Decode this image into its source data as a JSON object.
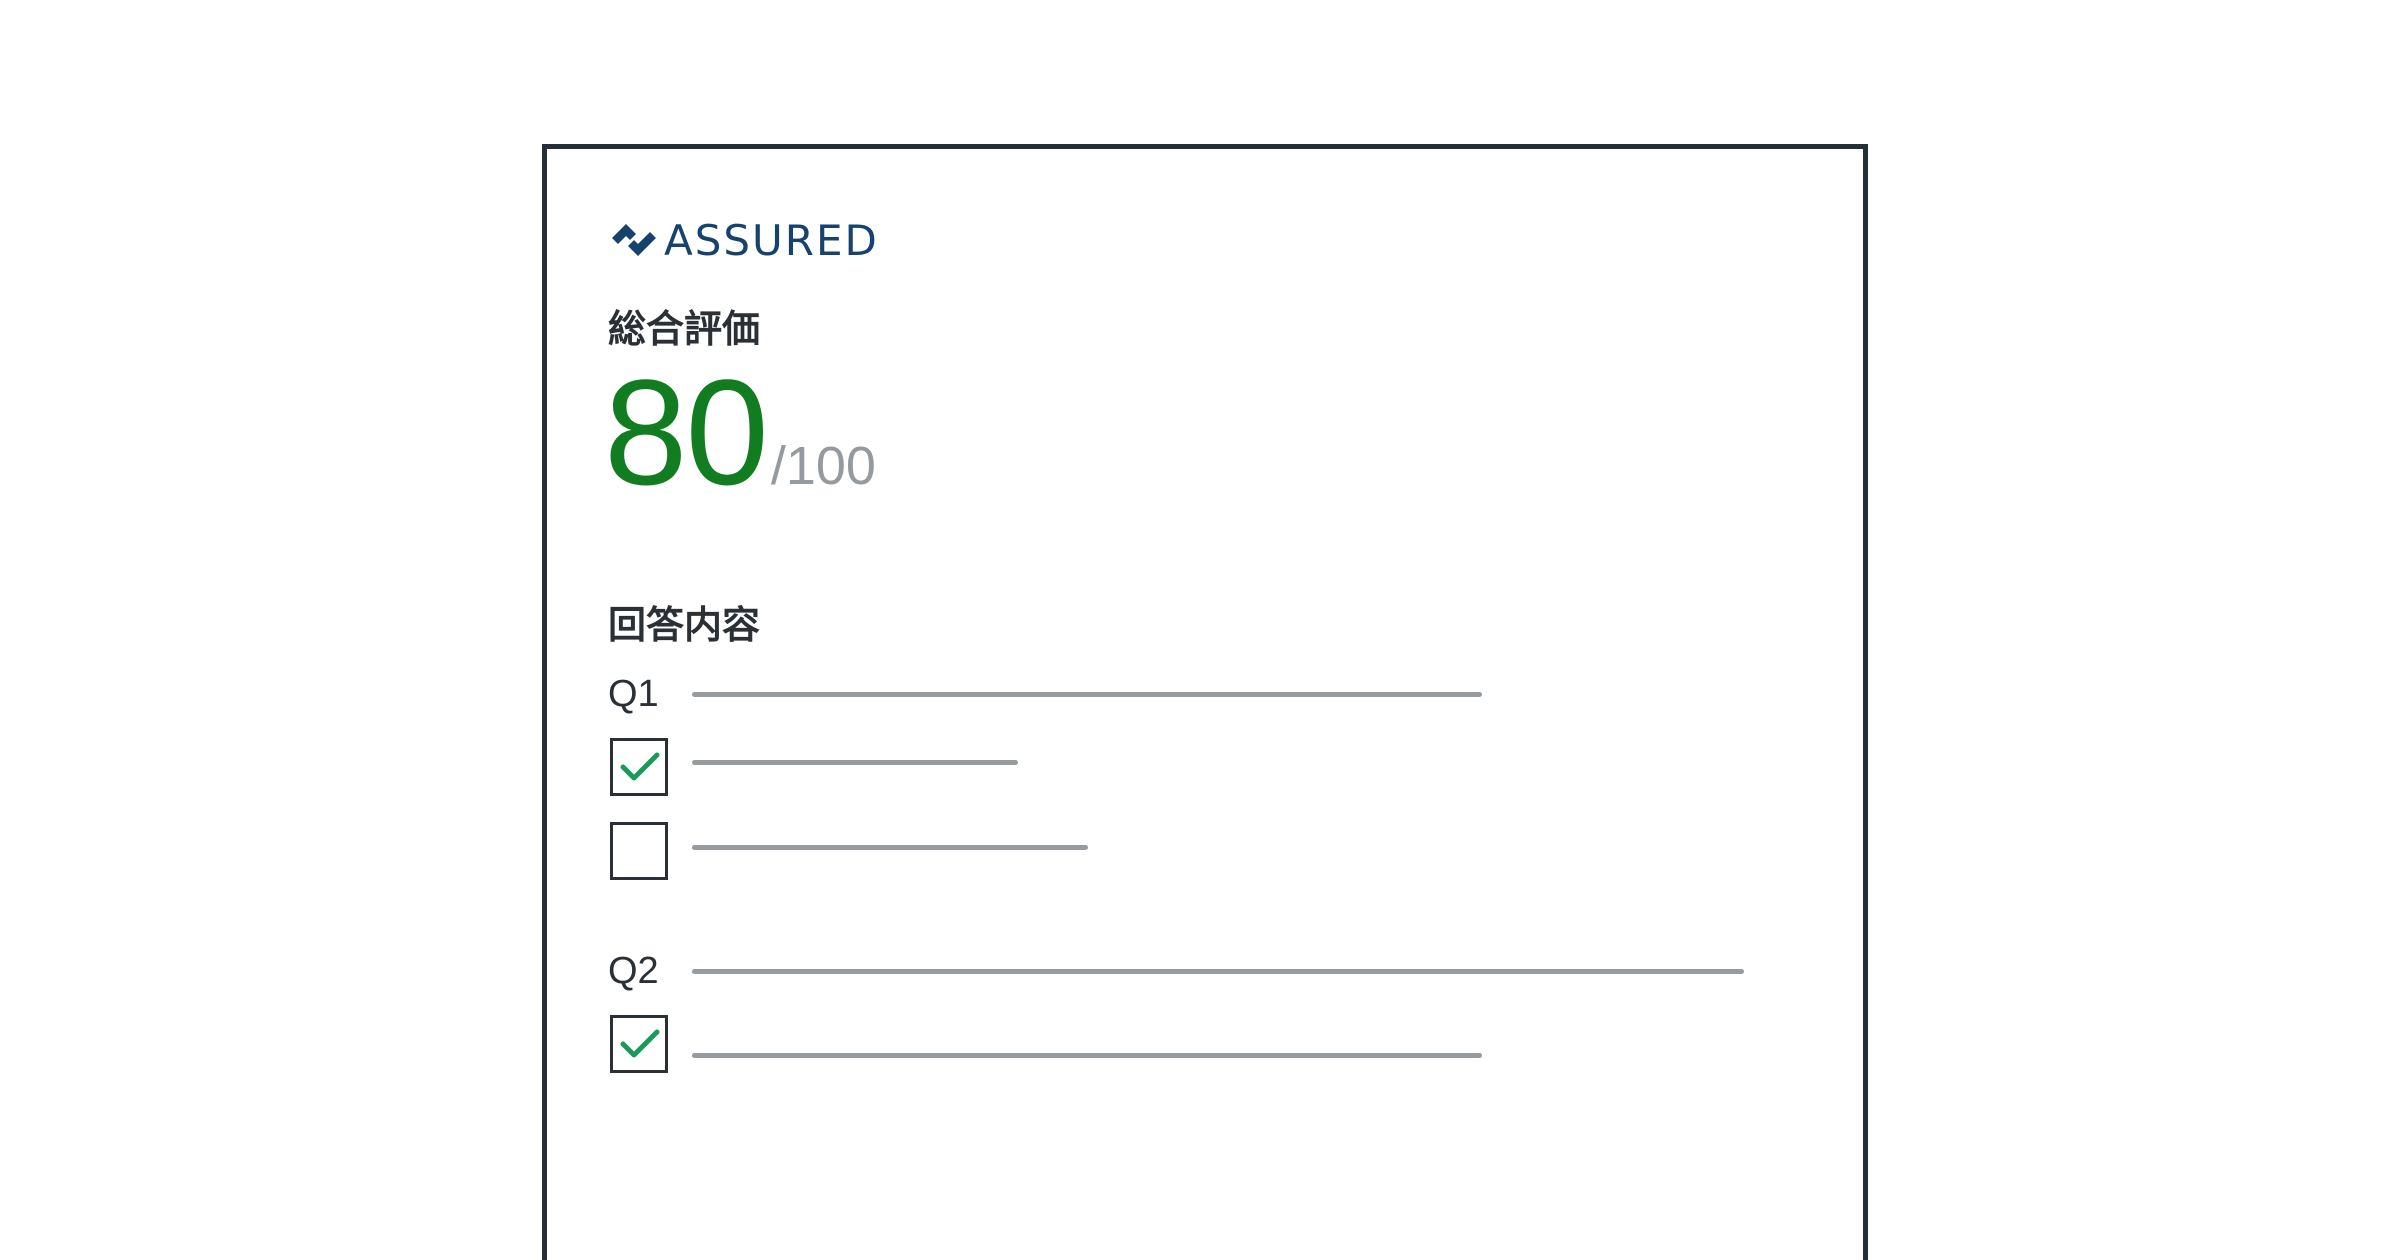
{
  "logo": {
    "text": "ASSURED",
    "mark_icon": "assured-logo-mark"
  },
  "score": {
    "heading": "総合評価",
    "value": "80",
    "total": "/100",
    "value_color": "#117d20"
  },
  "answers": {
    "heading": "回答内容",
    "questions": [
      {
        "label": "Q1",
        "options": [
          {
            "checked": true
          },
          {
            "checked": false
          }
        ]
      },
      {
        "label": "Q2",
        "options": [
          {
            "checked": true
          }
        ]
      }
    ]
  },
  "colors": {
    "border": "#243038",
    "text": "#2b3037",
    "placeholder_line": "#969ba0",
    "check": "#1a9a5a",
    "brand": "#16426e"
  }
}
